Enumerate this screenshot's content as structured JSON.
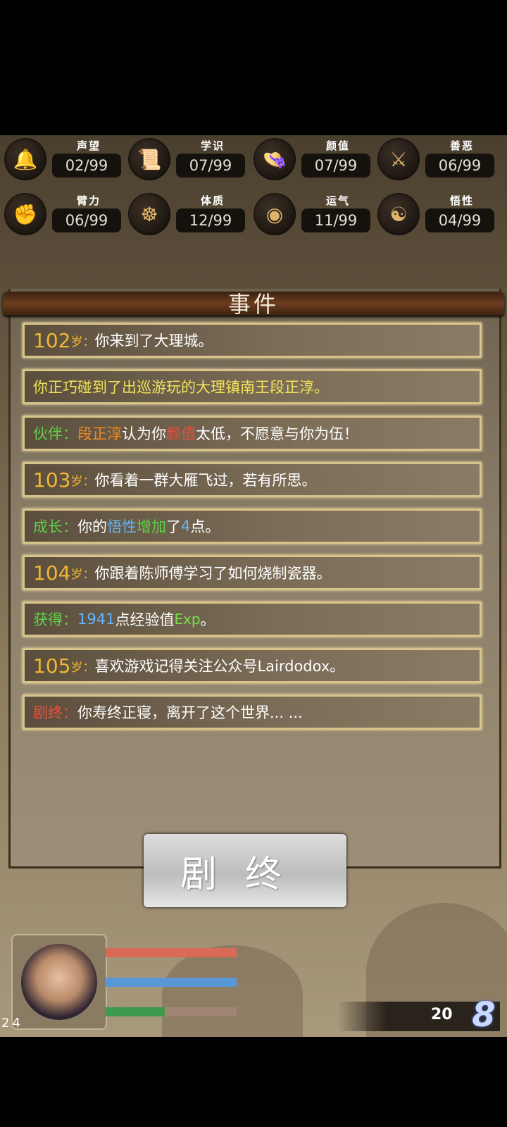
{
  "stats": [
    {
      "label": "声望",
      "value": "02/99",
      "icon": "bell-icon",
      "glyph": "🔔"
    },
    {
      "label": "学识",
      "value": "07/99",
      "icon": "scroll-icon",
      "glyph": "📜"
    },
    {
      "label": "颜值",
      "value": "07/99",
      "icon": "hat-icon",
      "glyph": "👒"
    },
    {
      "label": "善恶",
      "value": "06/99",
      "icon": "crossed-swords-icon",
      "glyph": "⚔"
    },
    {
      "label": "臂力",
      "value": "06/99",
      "icon": "fist-icon",
      "glyph": "✊"
    },
    {
      "label": "体质",
      "value": "12/99",
      "icon": "figure-icon",
      "glyph": "☸"
    },
    {
      "label": "运气",
      "value": "11/99",
      "icon": "coin-icon",
      "glyph": "◉"
    },
    {
      "label": "悟性",
      "value": "04/99",
      "icon": "head-icon",
      "glyph": "☯"
    }
  ],
  "panel": {
    "title": "事件"
  },
  "events": {
    "e1": {
      "age": "102",
      "sui": "岁：",
      "text": "你来到了大理城。"
    },
    "e2": {
      "text": "你正巧碰到了出巡游玩的大理镇南王段正淳。"
    },
    "e3": {
      "tag": "伙伴：",
      "name": "段正淳",
      "mid": " 认为你",
      "attr": "颜值",
      "tail": "太低，不愿意与你为伍！"
    },
    "e4": {
      "age": "103",
      "sui": "岁：",
      "text": "你看着一群大雁飞过，若有所思。"
    },
    "e5": {
      "tag": "成长：",
      "pre": "你的",
      "attr": "悟性",
      "act": " 增加 ",
      "unit1": " 了 ",
      "num": "4",
      "unit2": " 点。"
    },
    "e6": {
      "age": "104",
      "sui": "岁：",
      "text": "你跟着陈师傅学习了如何烧制瓷器。"
    },
    "e7": {
      "tag": "获得：",
      "num": "1941",
      "text": " 点经验值",
      "exp": "Exp",
      "end": " 。"
    },
    "e8": {
      "age": "105",
      "sui": "岁：",
      "text": "喜欢游戏记得关注公众号Lairdodox。"
    },
    "e9": {
      "tag": "剧终：",
      "text": "你寿终正寝，离开了这个世界... ..."
    }
  },
  "end_button": {
    "label": "剧终"
  },
  "player": {
    "level": "24",
    "hp_fill": 1.0,
    "mp_fill": 1.0,
    "exp_fill": 0.45
  },
  "currency": {
    "value": "20",
    "icon": "gem-icon",
    "glyph": "8"
  }
}
